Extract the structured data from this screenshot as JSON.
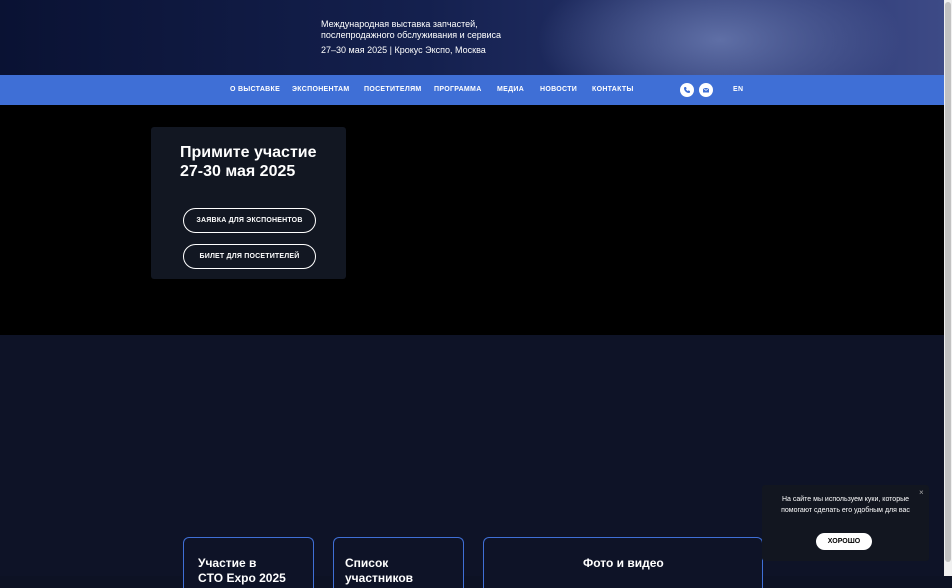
{
  "header": {
    "line1": "Международная выставка запчастей,",
    "line2": "послепродажного обслуживания и сервиса",
    "line3": "27–30 мая 2025 | Крокус Экспо, Москва"
  },
  "nav": {
    "items": [
      "О ВЫСТАВКЕ",
      "ЭКСПОНЕНТАМ",
      "ПОСЕТИТЕЛЯМ",
      "ПРОГРАММА",
      "МЕДИА",
      "НОВОСТИ",
      "КОНТАКТЫ"
    ],
    "lang": "EN",
    "icons": [
      "phone-icon",
      "mail-icon"
    ]
  },
  "hero": {
    "title_line1": "Примите участие",
    "title_line2": "27-30 мая 2025",
    "button_exhibitor": "ЗАЯВКА ДЛЯ ЭКСПОНЕНТОВ",
    "button_visitor": "БИЛЕТ ДЛЯ ПОСЕТИТЕЛЕЙ"
  },
  "tiles": {
    "t1_line1": "Участие в",
    "t1_line2": "CTO Expo 2025",
    "t2_line1": "Список",
    "t2_line2": "участников",
    "t3": "Фото и видео"
  },
  "cookie": {
    "text": "На сайте мы используем куки, которые помогают сделать его удобным для вас",
    "ok": "ХОРОШО",
    "close": "×"
  },
  "colors": {
    "nav_blue": "#3f6fd6",
    "header_dark": "#0a1233",
    "hero_bg": "#000000"
  }
}
